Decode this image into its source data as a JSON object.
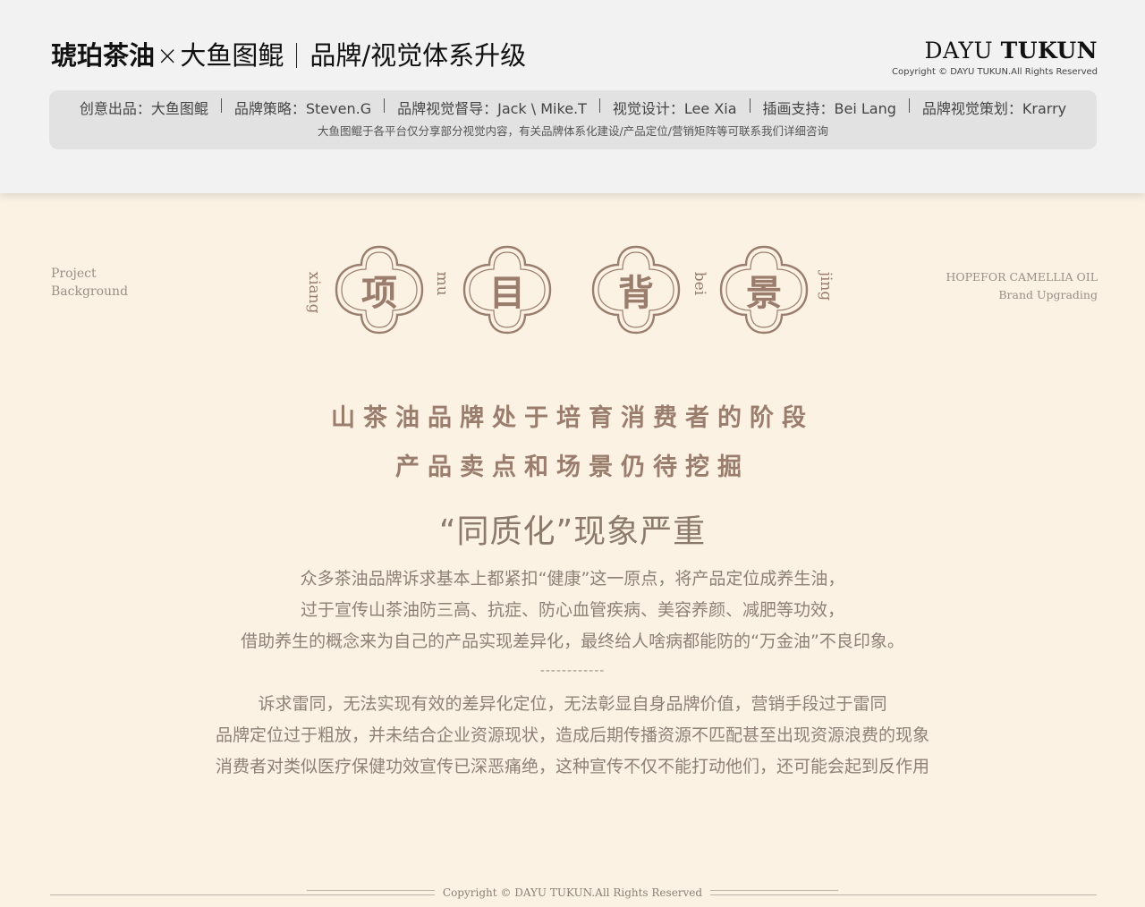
{
  "header": {
    "brand": "琥珀茶油",
    "cross": "×",
    "partner": "大鱼图鲲",
    "subject": "品牌/视觉体系升级",
    "logo_light": "DAYU",
    "logo_bold": "TUKUN",
    "copyright": "Copyright © DAYU TUKUN.All Rights Reserved"
  },
  "credits": {
    "items": [
      "创意出品：大鱼图鲲",
      "品牌策略：Steven.G",
      "品牌视觉督导：Jack \\ Mike.T",
      "视觉设计：Lee Xia",
      "插画支持：Bei Lang",
      "品牌视觉策划：Krarry"
    ],
    "note": "大鱼图鲲于各平台仅分享部分视觉内容，有关品牌体系化建设/产品定位/营销矩阵等可联系我们详细咨询"
  },
  "section": {
    "left_line1": "Project",
    "left_line2": "Background",
    "right_line1": "HOPEFOR CAMELLIA OIL",
    "right_line2": "Brand Upgrading",
    "characters": [
      "项",
      "目",
      "背",
      "景"
    ],
    "pinyin": [
      "xiang",
      "mu",
      "bei",
      "jing"
    ]
  },
  "content": {
    "lead1": "山茶油品牌处于培育消费者的阶段",
    "lead2": "产品卖点和场景仍待挖掘",
    "headline": "“同质化”现象严重",
    "para1": [
      "众多茶油品牌诉求基本上都紧扣“健康”这一原点，将产品定位成养生油，",
      "过于宣传山茶油防三高、抗症、防心血管疾病、美容养颜、减肥等功效，",
      "借助养生的概念来为自己的产品实现差异化，最终给人啥病都能防的“万金油”不良印象。"
    ],
    "divider": "------------",
    "para2": [
      "诉求雷同，无法实现有效的差异化定位，无法彰显自身品牌价值，营销手段过于雷同",
      "品牌定位过于粗放，并未结合企业资源现状，造成后期传播资源不匹配甚至出现资源浪费的现象",
      "消费者对类似医疗保健功效宣传已深恶痛绝，这种宣传不仅不能打动他们，还可能会起到反作用"
    ]
  },
  "footer": {
    "copyright": "Copyright © DAYU TUKUN.All Rights Reserved"
  },
  "colors": {
    "background": "#fbf2e4",
    "header_bg": "#f2f2f2",
    "accent_brown": "#9a7d6c",
    "body_text": "#8e8076"
  }
}
